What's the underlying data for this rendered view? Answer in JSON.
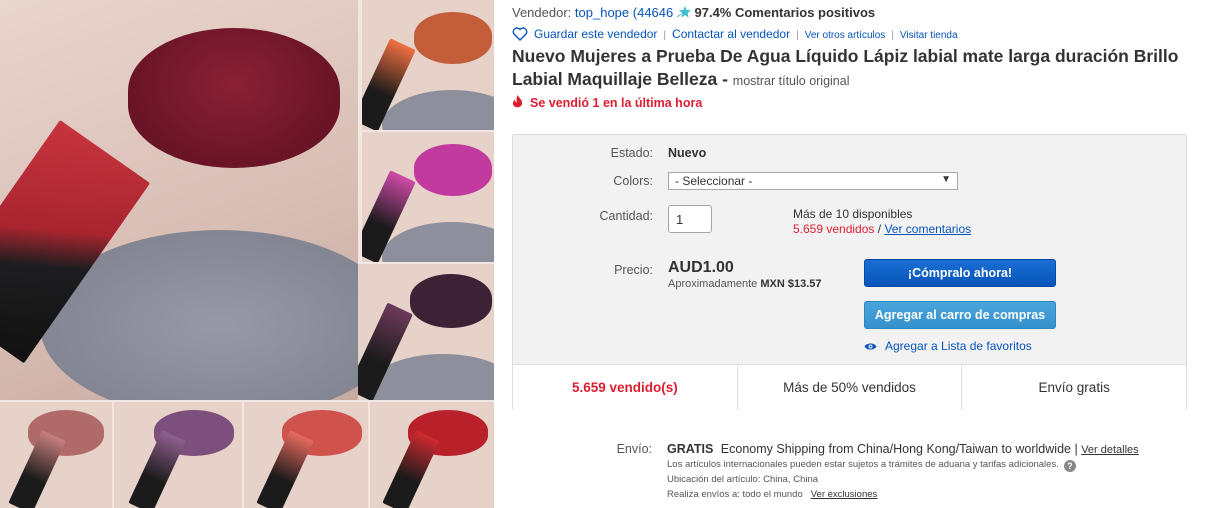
{
  "seller": {
    "label": "Vendedor:",
    "name": "top_hope",
    "feedback_count": "(44646",
    "star_icon": "shooting-star-icon",
    "star_color": "#3dbfcf",
    "positive_text": "97.4% Comentarios positivos"
  },
  "actions": {
    "save_seller": "Guardar este vendedor",
    "contact_seller": "Contactar al vendedor",
    "other_items": "Ver otros artículos",
    "visit_store": "Visitar tienda",
    "separator": "|"
  },
  "product": {
    "title": "Nuevo Mujeres a Prueba De Agua Líquido Lápiz labial mate larga duración Brillo Labial Maquillaje Belleza -",
    "show_original": "mostrar título original",
    "sold_last_hour": "Se vendió 1 en la última hora"
  },
  "purchase": {
    "condition_label": "Estado:",
    "condition_value": "Nuevo",
    "colors_label": "Colors:",
    "colors_selected": "- Seleccionar -",
    "quantity_label": "Cantidad:",
    "quantity_value": "1",
    "available": "Más de 10 disponibles",
    "sold_count": "5.659 vendidos",
    "slash": "/",
    "see_feedback": "Ver comentarios",
    "price_label": "Precio:",
    "price": "AUD1.00",
    "approx_label": "Aproximadamente",
    "approx_value": "MXN $13.57",
    "buy_now": "¡Cómpralo ahora!",
    "add_to_cart": "Agregar al carro de compras",
    "add_watchlist": "Agregar a Lista de favoritos"
  },
  "stats": [
    "5.659 vendido(s)",
    "Más de 50% vendidos",
    "Envío gratis"
  ],
  "shipping": {
    "label": "Envío:",
    "free": "GRATIS",
    "method": "Economy Shipping from China/Hong Kong/Taiwan to worldwide |",
    "details_link": "Ver detalles",
    "customs_note": "Los artículos internacionales pueden estar sujetos a trámites de aduana y tarifas adicionales.",
    "location": "Ubicación del artículo:  China, China",
    "ships_to": "Realiza envíos a:  todo el mundo",
    "exclusions_link": "Ver exclusiones"
  },
  "colors": {
    "link": "#0654ba",
    "alert_red": "#dd1e31",
    "buy_button": "#0654ba",
    "cart_button": "#3591cc"
  }
}
